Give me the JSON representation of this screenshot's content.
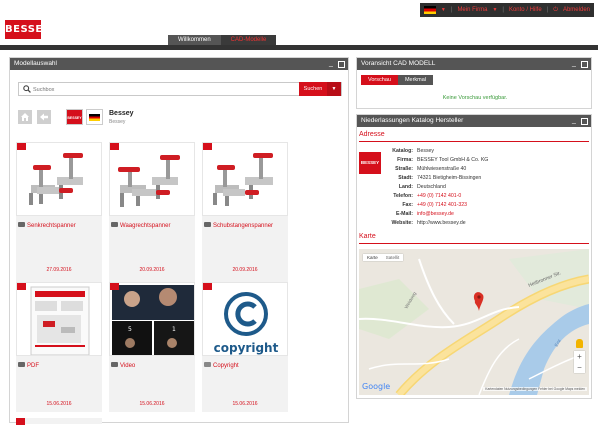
{
  "header": {
    "logo_text": "BESSEY",
    "usermenu": {
      "country": "Mein Firma",
      "account": "Konto / Hilfe",
      "logout": "Abmelden"
    },
    "tabs": [
      {
        "label": "Willkommen",
        "active": true
      },
      {
        "label": "CAD-Modelle",
        "active": false
      }
    ]
  },
  "left_panel": {
    "title": "Modellauswahl",
    "search": {
      "placeholder": "Suchbox",
      "button": "Suchen",
      "dropdown": "▼"
    },
    "brand": {
      "logo": "BESSEY",
      "name": "Bessey",
      "sub": "Bessey"
    },
    "tiles": [
      {
        "label": "Senkrechtspanner",
        "date": "27.09.2016",
        "image": "toggle-clamp"
      },
      {
        "label": "Waagrechtspanner",
        "date": "20.09.2016",
        "image": "toggle-clamp"
      },
      {
        "label": "Schubstangenspanner",
        "date": "20.09.2016",
        "image": "toggle-clamp"
      },
      {
        "label": "PDF",
        "date": "15.06.2016",
        "image": "pdf-catalog"
      },
      {
        "label": "Video",
        "date": "15.06.2016",
        "image": "video-grid"
      },
      {
        "label": "Copyright",
        "date": "15.06.2016",
        "image": "copyright",
        "copyright_word": "copyright"
      }
    ]
  },
  "preview_panel": {
    "title": "Voransicht CAD MODELL",
    "tabs": [
      "Vorschau",
      "Merkmal"
    ],
    "empty_message": "Keine Vorschau verfügbar."
  },
  "branches_panel": {
    "title": "Niederlassungen Katalog Hersteller",
    "address_title": "Adresse",
    "logo": "BESSEY",
    "address": [
      {
        "key": "Katalog:",
        "value": "Bessey",
        "link": false
      },
      {
        "key": "Firma:",
        "value": "BESSEY Tool GmbH & Co. KG",
        "link": false
      },
      {
        "key": "Straße:",
        "value": "Mühlwiesenstraße 40",
        "link": false
      },
      {
        "key": "Stadt:",
        "value": "74321 Bietigheim-Bissingen",
        "link": false
      },
      {
        "key": "Land:",
        "value": "Deutschland",
        "link": false
      },
      {
        "key": "Telefon:",
        "value": "+49 (0) 7142 401-0",
        "link": true
      },
      {
        "key": "Fax:",
        "value": "+49 (0) 7142 401-323",
        "link": true
      },
      {
        "key": "E-Mail:",
        "value": "info@bessey.de",
        "link": true
      },
      {
        "key": "Website:",
        "value": "http://www.bessey.de",
        "link": false
      }
    ],
    "map_title": "Karte",
    "map": {
      "tabs": [
        "Karte",
        "Satellit"
      ],
      "road_label": "Heilbronner Str.",
      "street_label": "Weidweg",
      "river_label": "Enz",
      "google": "Google",
      "footer": "Kartendaten   Nutzungsbedingungen   Fehler bei Google Maps melden"
    }
  }
}
